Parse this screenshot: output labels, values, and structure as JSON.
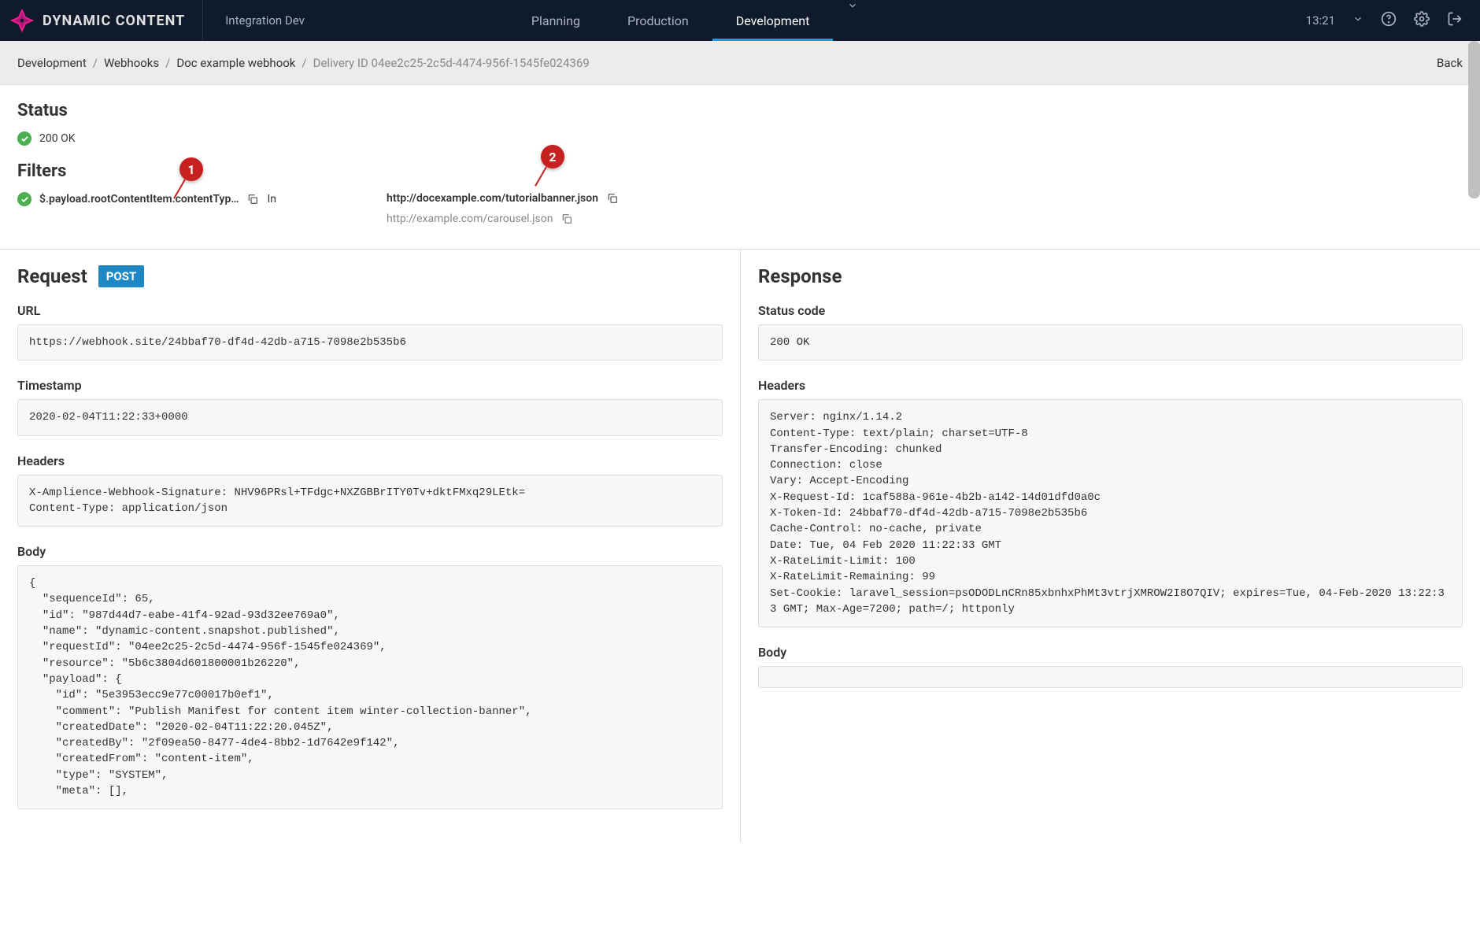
{
  "header": {
    "product": "DYNAMIC CONTENT",
    "hub": "Integration Dev",
    "tabs": [
      "Planning",
      "Production",
      "Development"
    ],
    "active_tab": "Development",
    "time": "13:21"
  },
  "breadcrumb": {
    "items": [
      "Development",
      "Webhooks",
      "Doc example webhook"
    ],
    "current": "Delivery ID 04ee2c25-2c5d-4474-956f-1545fe024369",
    "back": "Back"
  },
  "status": {
    "title": "Status",
    "text": "200 OK"
  },
  "filters": {
    "title": "Filters",
    "path": "$.payload.rootContentItem.contentTyp…",
    "suffix": "In",
    "urls": [
      {
        "url": "http://docexample.com/tutorialbanner.json",
        "primary": true
      },
      {
        "url": "http://example.com/carousel.json",
        "primary": false
      }
    ]
  },
  "callouts": {
    "one": "1",
    "two": "2"
  },
  "request": {
    "title": "Request",
    "method": "POST",
    "url_label": "URL",
    "url": "https://webhook.site/24bbaf70-df4d-42db-a715-7098e2b535b6",
    "timestamp_label": "Timestamp",
    "timestamp": "2020-02-04T11:22:33+0000",
    "headers_label": "Headers",
    "headers": "X-Amplience-Webhook-Signature: NHV96PRsl+TFdgc+NXZGBBrITY0Tv+dktFMxq29LEtk=\nContent-Type: application/json",
    "body_label": "Body",
    "body": "{\n  \"sequenceId\": 65,\n  \"id\": \"987d44d7-eabe-41f4-92ad-93d32ee769a0\",\n  \"name\": \"dynamic-content.snapshot.published\",\n  \"requestId\": \"04ee2c25-2c5d-4474-956f-1545fe024369\",\n  \"resource\": \"5b6c3804d601800001b26220\",\n  \"payload\": {\n    \"id\": \"5e3953ecc9e77c00017b0ef1\",\n    \"comment\": \"Publish Manifest for content item winter-collection-banner\",\n    \"createdDate\": \"2020-02-04T11:22:20.045Z\",\n    \"createdBy\": \"2f09ea50-8477-4de4-8bb2-1d7642e9f142\",\n    \"createdFrom\": \"content-item\",\n    \"type\": \"SYSTEM\",\n    \"meta\": [],"
  },
  "response": {
    "title": "Response",
    "status_label": "Status code",
    "status": "200 OK",
    "headers_label": "Headers",
    "headers": "Server: nginx/1.14.2\nContent-Type: text/plain; charset=UTF-8\nTransfer-Encoding: chunked\nConnection: close\nVary: Accept-Encoding\nX-Request-Id: 1caf588a-961e-4b2b-a142-14d01dfd0a0c\nX-Token-Id: 24bbaf70-df4d-42db-a715-7098e2b535b6\nCache-Control: no-cache, private\nDate: Tue, 04 Feb 2020 11:22:33 GMT\nX-RateLimit-Limit: 100\nX-RateLimit-Remaining: 99\nSet-Cookie: laravel_session=psODODLnCRn85xbnhxPhMt3vtrjXMROW2I8O7QIV; expires=Tue, 04-Feb-2020 13:22:33 GMT; Max-Age=7200; path=/; httponly",
    "body_label": "Body",
    "body": ""
  }
}
